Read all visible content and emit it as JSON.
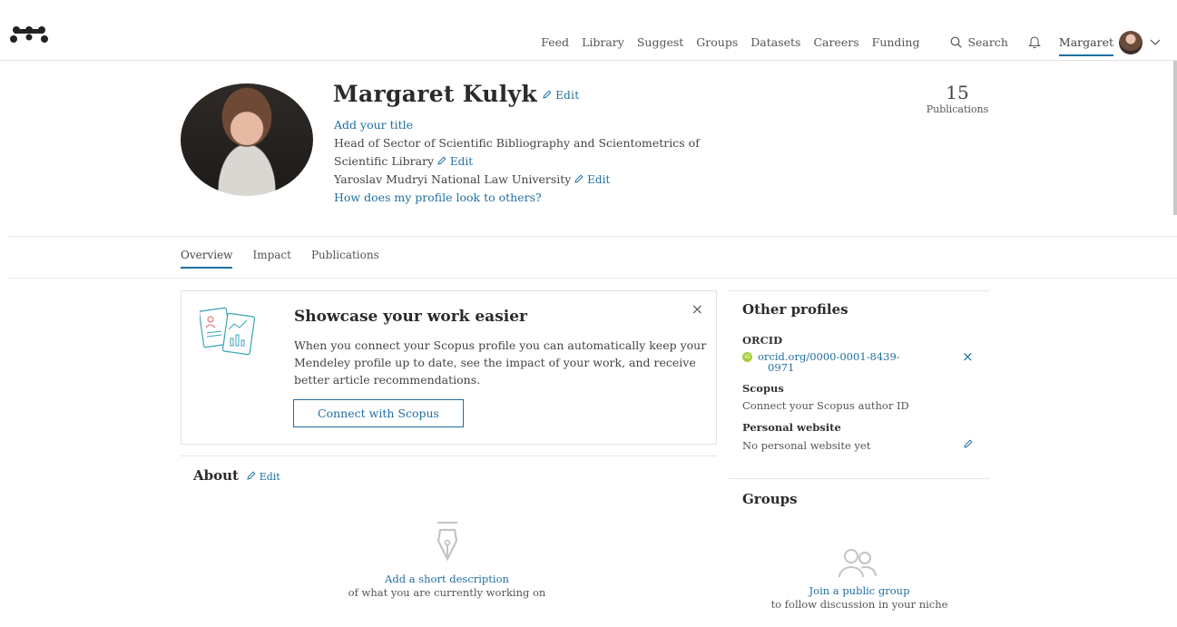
{
  "nav": {
    "items": [
      "Feed",
      "Library",
      "Suggest",
      "Groups",
      "Datasets",
      "Careers",
      "Funding"
    ],
    "search_label": "Search",
    "user_name": "Margaret"
  },
  "profile": {
    "name": "Margaret Kulyk",
    "edit_label": "Edit",
    "add_title": "Add your title",
    "position": "Head of Sector of Scientific Bibliography and Scientometrics of Scientific Library",
    "institution": "Yaroslav Mudryi National Law University",
    "look_link": "How does my profile look to others?",
    "publications_count": "15",
    "publications_label": "Publications"
  },
  "tabs": [
    "Overview",
    "Impact",
    "Publications"
  ],
  "showcase": {
    "title": "Showcase your work easier",
    "body": "When you connect your Scopus profile you can automatically keep your Mendeley profile up to date, see the impact of your work, and receive better article recommendations.",
    "button": "Connect with Scopus",
    "close": "×"
  },
  "about": {
    "title": "About",
    "edit": "Edit",
    "empty_link": "Add a short description",
    "empty_text": "of what you are currently working on"
  },
  "other_profiles": {
    "title": "Other profiles",
    "orcid_label": "ORCID",
    "orcid_badge": "iD",
    "orcid_value_line1": "orcid.org/0000-0001-8439-",
    "orcid_value_line2": "0971",
    "orcid_remove": "×",
    "scopus_label": "Scopus",
    "scopus_link": "Connect your Scopus author ID",
    "website_label": "Personal website",
    "website_value": "No personal website yet"
  },
  "groups": {
    "title": "Groups",
    "empty_link": "Join a public group",
    "empty_text": "to follow discussion in your niche"
  },
  "colors": {
    "link": "#1f6fa1",
    "orcid": "#a6ce39",
    "border": "#e2e2e2"
  }
}
